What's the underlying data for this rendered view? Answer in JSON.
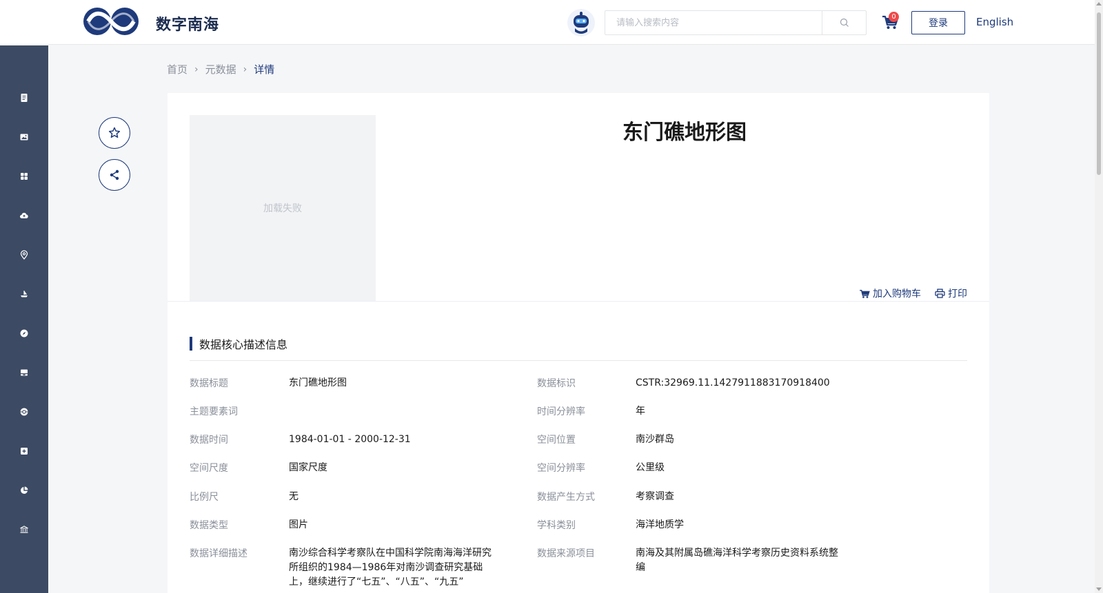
{
  "header": {
    "logo_text": "数字南海",
    "search_placeholder": "请输入搜索内容",
    "cart_count": "0",
    "login_label": "登录",
    "language_label": "English"
  },
  "sidebar": {
    "icons": [
      "document-icon",
      "image-icon",
      "grid-icon",
      "cloud-icon",
      "location-pin-icon",
      "ship-icon",
      "compass-icon",
      "archive-icon",
      "globe-icon",
      "plus-square-icon",
      "pie-chart-icon",
      "building-icon"
    ]
  },
  "breadcrumb": {
    "items": [
      "首页",
      "元数据",
      "详情"
    ]
  },
  "detail": {
    "title": "东门礁地形图",
    "image_placeholder": "加载失败",
    "add_to_cart": "加入购物车",
    "print": "打印"
  },
  "section": {
    "title": "数据核心描述信息"
  },
  "metadata": {
    "rows": [
      {
        "label1": "数据标题",
        "value1": "东门礁地形图",
        "label2": "数据标识",
        "value2": "CSTR:32969.11.1427911883170918400"
      },
      {
        "label1": "主题要素词",
        "value1": "",
        "label2": "时间分辨率",
        "value2": "年"
      },
      {
        "label1": "数据时间",
        "value1": "1984-01-01 - 2000-12-31",
        "label2": "空间位置",
        "value2": "南沙群岛"
      },
      {
        "label1": "空间尺度",
        "value1": "国家尺度",
        "label2": "空间分辨率",
        "value2": "公里级"
      },
      {
        "label1": "比例尺",
        "value1": "无",
        "label2": "数据产生方式",
        "value2": "考察调查"
      },
      {
        "label1": "数据类型",
        "value1": "图片",
        "label2": "学科类别",
        "value2": "海洋地质学"
      },
      {
        "label1": "数据详细描述",
        "value1": "南沙综合科学考察队在中国科学院南海海洋研究所组织的1984—1986年对南沙调查研究基础上，继续进行了“七五”、“八五”、“九五”",
        "label2": "数据来源项目",
        "value2": "南海及其附属岛礁海洋科学考察历史资料系统整编"
      }
    ]
  },
  "colors": {
    "brand": "#1e3a7b",
    "sidebar": "#3c4a63",
    "badge": "#f04848"
  }
}
